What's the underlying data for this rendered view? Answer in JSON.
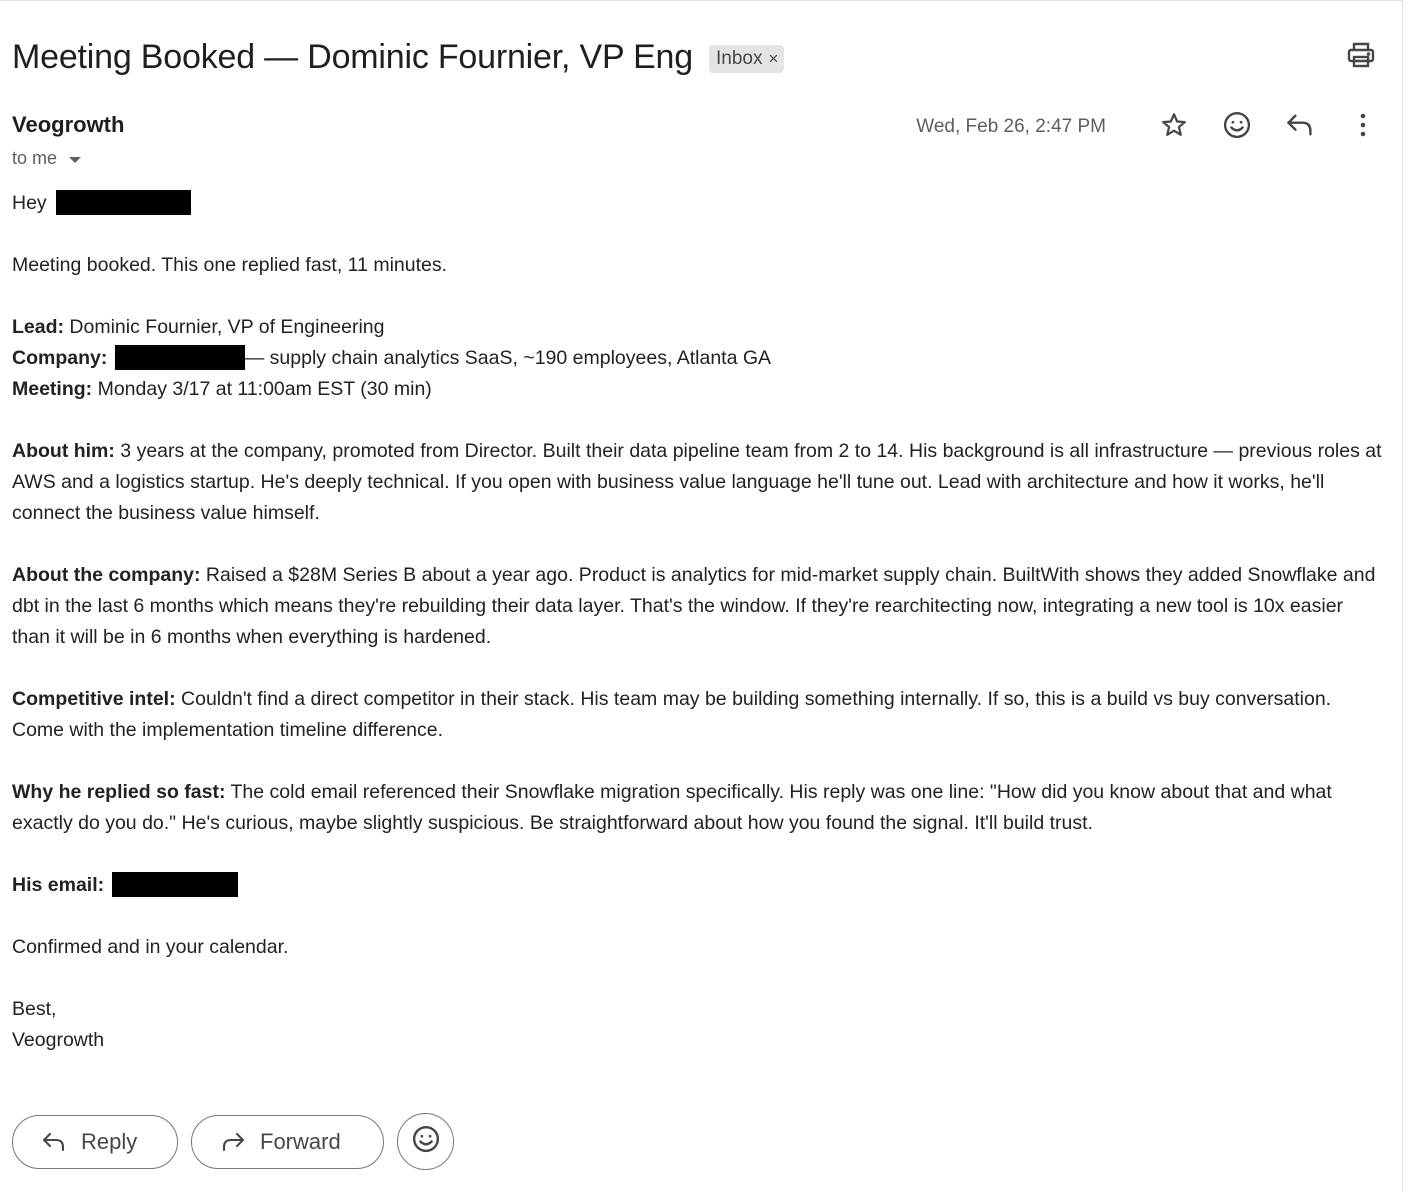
{
  "email": {
    "subject": "Meeting Booked — Dominic Fournier, VP Eng",
    "label": "Inbox",
    "label_remove": "×",
    "sender": "Veogrowth",
    "recipient": "to me",
    "timestamp": "Wed, Feb 26, 2:47 PM",
    "body": {
      "greeting": "Hey",
      "intro": "Meeting booked. This one replied fast, 11 minutes.",
      "lead_label": "Lead:",
      "lead_value": " Dominic Fournier, VP of Engineering",
      "company_label": "Company:",
      "company_value": "— supply chain analytics SaaS, ~190 employees, Atlanta GA",
      "meeting_label": "Meeting:",
      "meeting_value": " Monday 3/17 at 11:00am EST (30 min)",
      "about_him_label": "About him:",
      "about_him_text": " 3 years at the company, promoted from Director. Built their data pipeline team from 2 to 14. His background is all infrastructure — previous roles at AWS and a logistics startup. He's deeply technical. If you open with business value language he'll tune out. Lead with architecture and how it works, he'll connect the business value himself.",
      "about_company_label": "About the company:",
      "about_company_text": " Raised a $28M Series B about a year ago. Product is analytics for mid-market supply chain. BuiltWith shows they added Snowflake and dbt in the last 6 months which means they're rebuilding their data layer. That's the window. If they're rearchitecting now, integrating a new tool is 10x easier than it will be in 6 months when everything is hardened.",
      "competitive_label": "Competitive intel:",
      "competitive_text": " Couldn't find a direct competitor in their stack. His team may be building something internally. If so, this is a build vs buy conversation. Come with the implementation timeline difference.",
      "why_label": "Why he replied so fast:",
      "why_text": " The cold email referenced their Snowflake migration specifically. His reply was one line: \"How did you know about that and what exactly do you do.\" He's curious, maybe slightly suspicious. Be straightforward about how you found the signal. It'll build trust.",
      "email_label": "His email:",
      "confirmation": "Confirmed and in your calendar.",
      "signoff": "Best,",
      "signature": "Veogrowth"
    }
  },
  "actions": {
    "reply_label": "Reply",
    "forward_label": "Forward"
  },
  "icons": {
    "print": "print-icon",
    "star": "star-icon",
    "emoji": "emoji-icon",
    "reply": "reply-icon",
    "more": "more-vert-icon",
    "forward": "forward-icon",
    "dropdown": "caret-down-icon"
  },
  "colors": {
    "text": "#222222",
    "muted": "#5e5e5e",
    "chip_bg": "#e4e4e4",
    "redaction": "#000000",
    "button_border": "#747775"
  }
}
